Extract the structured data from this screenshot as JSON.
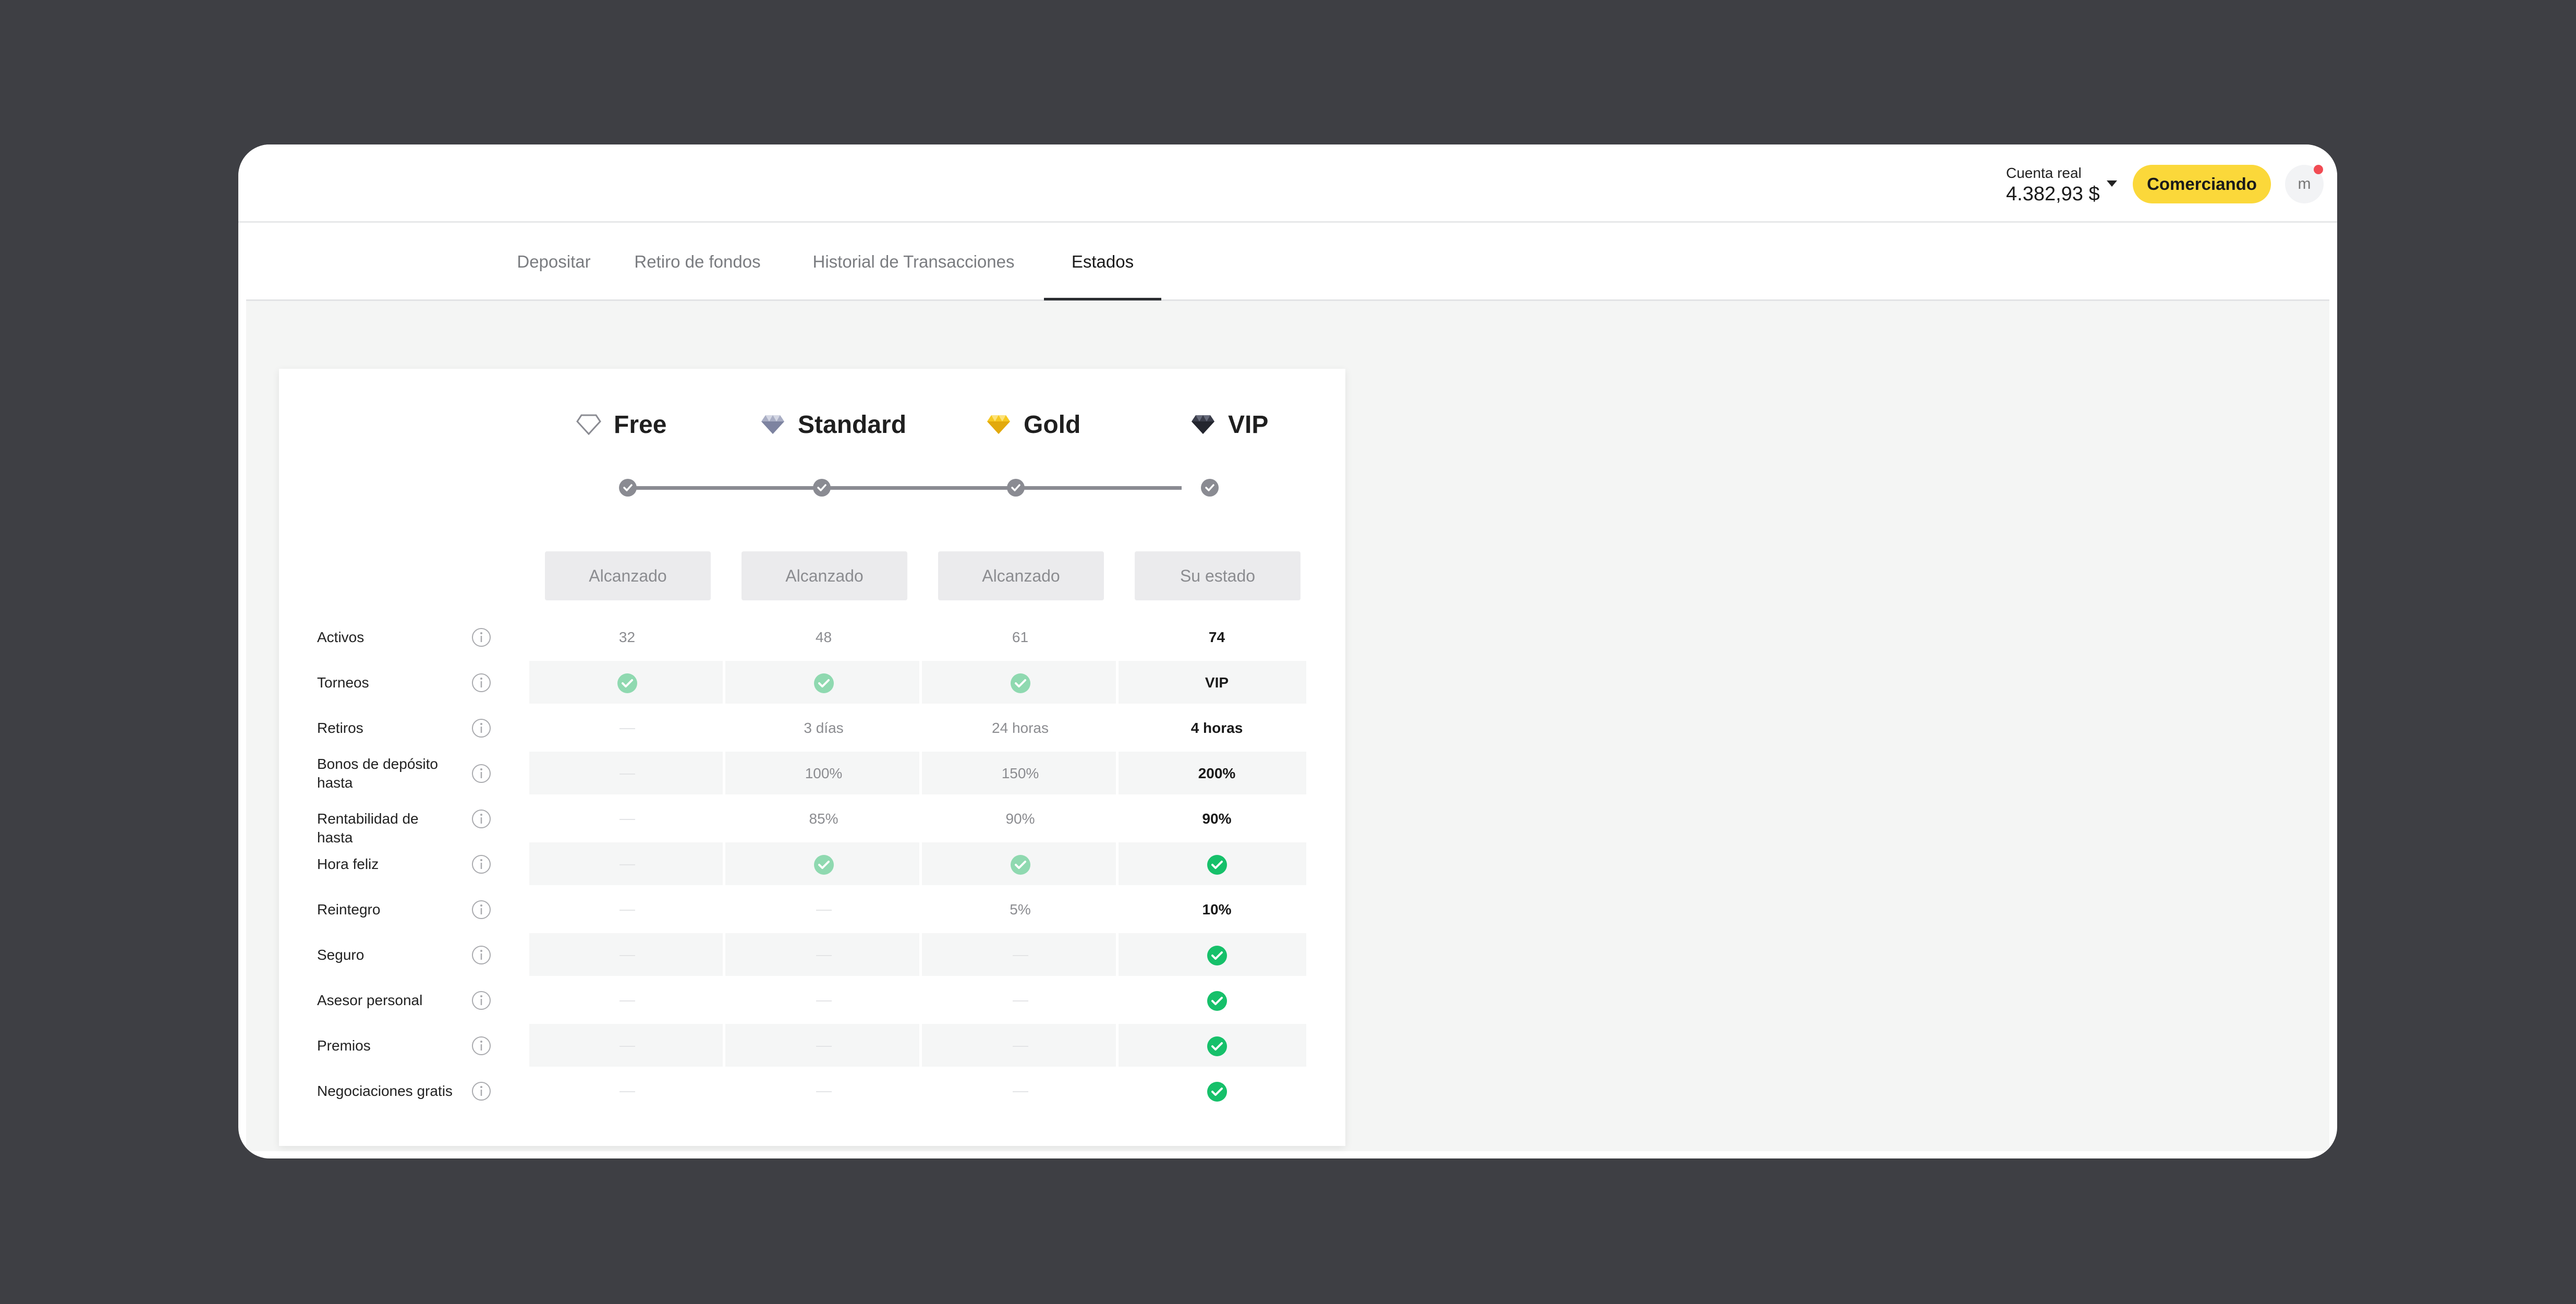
{
  "header": {
    "account_label": "Cuenta real",
    "account_balance": "4.382,93 $",
    "trade_button": "Comerciando",
    "avatar_initial": "m"
  },
  "tabs": [
    {
      "label": "Depositar",
      "active": false
    },
    {
      "label": "Retiro de fondos",
      "active": false
    },
    {
      "label": "Historial de Transacciones",
      "active": false
    },
    {
      "label": "Estados",
      "active": true
    }
  ],
  "tiers": [
    {
      "name": "Free",
      "icon": "diamond-outline-icon",
      "status": "Alcanzado"
    },
    {
      "name": "Standard",
      "icon": "diamond-silver-icon",
      "status": "Alcanzado"
    },
    {
      "name": "Gold",
      "icon": "diamond-gold-icon",
      "status": "Alcanzado"
    },
    {
      "name": "VIP",
      "icon": "diamond-dark-icon",
      "status": "Su estado"
    }
  ],
  "rows": [
    {
      "label": "Activos",
      "cells": [
        "32",
        "48",
        "61",
        "74"
      ]
    },
    {
      "label": "Torneos",
      "cells": [
        "check",
        "check",
        "check",
        "VIP"
      ]
    },
    {
      "label": "Retiros",
      "cells": [
        "dash",
        "3 días",
        "24 horas",
        "4 horas"
      ]
    },
    {
      "label": "Bonos de depósito hasta",
      "cells": [
        "dash",
        "100%",
        "150%",
        "200%"
      ]
    },
    {
      "label": "Rentabilidad de hasta",
      "cells": [
        "dash",
        "85%",
        "90%",
        "90%"
      ]
    },
    {
      "label": "Hora feliz",
      "cells": [
        "dash",
        "check",
        "check",
        "check"
      ]
    },
    {
      "label": "Reintegro",
      "cells": [
        "dash",
        "dash",
        "5%",
        "10%"
      ]
    },
    {
      "label": "Seguro",
      "cells": [
        "dash",
        "dash",
        "dash",
        "check"
      ]
    },
    {
      "label": "Asesor personal",
      "cells": [
        "dash",
        "dash",
        "dash",
        "check"
      ]
    },
    {
      "label": "Premios",
      "cells": [
        "dash",
        "dash",
        "dash",
        "check"
      ]
    },
    {
      "label": "Negociaciones gratis",
      "cells": [
        "dash",
        "dash",
        "dash",
        "check"
      ]
    }
  ],
  "colors": {
    "accent_yellow": "#fbd83a",
    "check_light": "#8fd9b0",
    "check_strong": "#16c06a",
    "notification": "#f14b53"
  }
}
